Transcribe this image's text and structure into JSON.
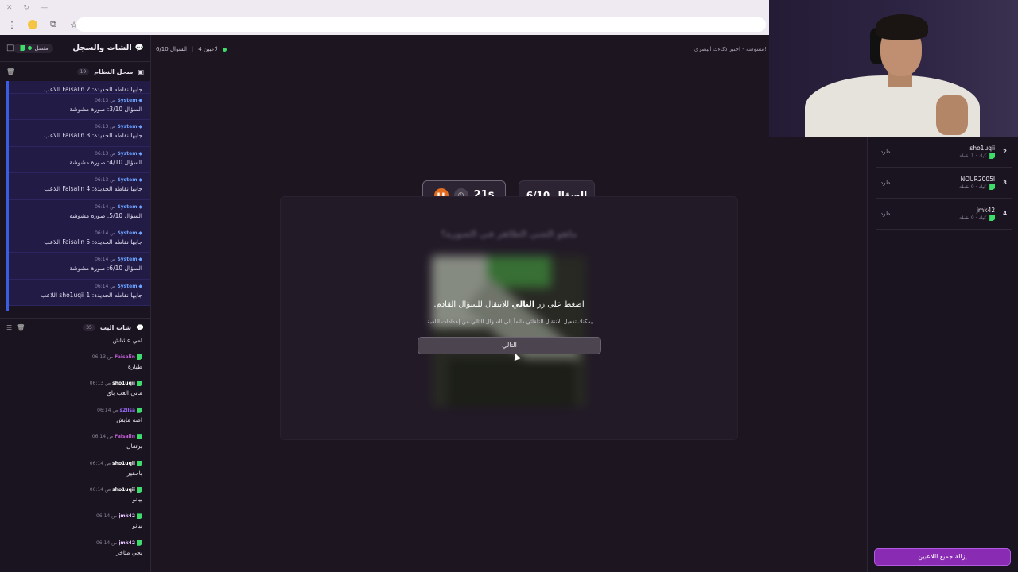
{
  "left_panel": {
    "title": "الشات والسجل",
    "status": "متصل",
    "system_log": {
      "title": "سجل النظام",
      "count": "19",
      "first_text": "اللاعب Faisalin جابها نقاطه الجديدة: 2",
      "items": [
        {
          "time": "06:13 ص",
          "source": "System",
          "text": "السؤال 3/10: صورة مشوشة"
        },
        {
          "time": "06:13 ص",
          "source": "System",
          "text": "اللاعب Faisalin جابها نقاطه الجديدة: 3"
        },
        {
          "time": "06:13 ص",
          "source": "System",
          "text": "السؤال 4/10: صورة مشوشة"
        },
        {
          "time": "06:13 ص",
          "source": "System",
          "text": "اللاعب Faisalin جابها نقاطه الجديدة: 4"
        },
        {
          "time": "06:14 ص",
          "source": "System",
          "text": "السؤال 5/10: صورة مشوشة"
        },
        {
          "time": "06:14 ص",
          "source": "System",
          "text": "اللاعب Faisalin جابها نقاطه الجديدة: 5"
        },
        {
          "time": "06:14 ص",
          "source": "System",
          "text": "السؤال 6/10: صورة مشوشة"
        },
        {
          "time": "06:14 ص",
          "source": "System",
          "text": "اللاعب sho1uqii جابها نقاطه الجديدة: 1"
        }
      ]
    },
    "live_chat": {
      "title": "شات البث",
      "count": "35",
      "first_text": "امي عشاش",
      "items": [
        {
          "time": "06:13 ص",
          "user": "Faisalin",
          "color": "#c05fd6",
          "text": "طيارة"
        },
        {
          "time": "06:13 ص",
          "user": "sho1uqii",
          "color": "#ffffff",
          "text": "ماني العب باي"
        },
        {
          "time": "06:14 ص",
          "user": "s2llsa",
          "color": "#9d6cff",
          "text": "اصه مابش"
        },
        {
          "time": "06:14 ص",
          "user": "Faisalin",
          "color": "#c05fd6",
          "text": "برتقال"
        },
        {
          "time": "06:14 ص",
          "user": "sho1uqii",
          "color": "#ffffff",
          "text": "باحقير"
        },
        {
          "time": "06:14 ص",
          "user": "sho1uqii",
          "color": "#ffffff",
          "text": "بيانو"
        },
        {
          "time": "06:14 ص",
          "user": "jmk42",
          "color": "#e6c7ff",
          "text": "بيانو"
        },
        {
          "time": "06:14 ص",
          "user": "jmk42",
          "color": "#e6c7ff",
          "text": "يجي متاخر"
        }
      ]
    }
  },
  "header": {
    "players": "4 لاعبين",
    "question": "السؤال 6/10",
    "game_title": "مشوشة - اختبر ذكاءك البصري!"
  },
  "game": {
    "question_label": "السؤال 6/10",
    "timer": "21s",
    "card_title": "ماهو الشي الظاهر في الصورة؟",
    "msg_prefix": "اضغط على زر",
    "msg_bold": "التالي",
    "msg_suffix": "للانتقال للسؤال القادم.",
    "sub_msg": "يمكنك تفعيل الانتقال التلقائي دائماً إلى السؤال التالي من إعدادات اللعبة.",
    "next_button": "التالي"
  },
  "players_panel": {
    "players": [
      {
        "rank": "2",
        "name": "sho1uqii",
        "sub": "كيك · 1 نقطة",
        "kick": "طرد"
      },
      {
        "rank": "3",
        "name": "NOUR2005I",
        "sub": "كيك · 0 نقطة",
        "kick": "طرد"
      },
      {
        "rank": "4",
        "name": "jmk42",
        "sub": "كيك · 0 نقطة",
        "kick": "طرد"
      }
    ],
    "remove_all": "إزالة جميع اللاعبين"
  },
  "colors": {
    "accent": "#8a2bb3",
    "system_blue": "#3b5ee0",
    "timer_orange": "#e26b1d",
    "online_green": "#3ddc6b"
  }
}
